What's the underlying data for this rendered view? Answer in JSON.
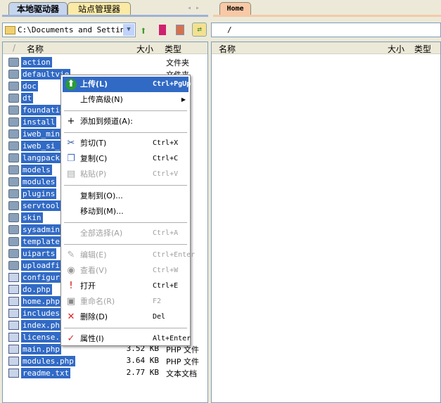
{
  "tabs": {
    "local": "本地驱动器",
    "site": "站点管理器",
    "remote": "Home"
  },
  "local": {
    "path": "C:\\Documents and Settings",
    "columns": {
      "name": "名称",
      "size": "大小",
      "type": "类型"
    },
    "files": [
      {
        "name": "action",
        "size": "",
        "type": "文件夹",
        "kind": "folder"
      },
      {
        "name": "defaultvie",
        "size": "",
        "type": "文件夹",
        "kind": "folder"
      },
      {
        "name": "doc",
        "size": "",
        "type": "",
        "kind": "folder"
      },
      {
        "name": "dt",
        "size": "",
        "type": "",
        "kind": "folder"
      },
      {
        "name": "foundation",
        "size": "",
        "type": "",
        "kind": "folder"
      },
      {
        "name": "install",
        "size": "",
        "type": "",
        "kind": "folder"
      },
      {
        "name": "iweb_mini_",
        "size": "",
        "type": "",
        "kind": "folder"
      },
      {
        "name": "iweb_si_li",
        "size": "",
        "type": "",
        "kind": "folder"
      },
      {
        "name": "langpacka",
        "size": "",
        "type": "",
        "kind": "folder"
      },
      {
        "name": "models",
        "size": "",
        "type": "",
        "kind": "folder"
      },
      {
        "name": "modules",
        "size": "",
        "type": "",
        "kind": "folder"
      },
      {
        "name": "plugins",
        "size": "",
        "type": "",
        "kind": "folder"
      },
      {
        "name": "servtools",
        "size": "",
        "type": "",
        "kind": "folder"
      },
      {
        "name": "skin",
        "size": "",
        "type": "",
        "kind": "folder"
      },
      {
        "name": "sysadmin",
        "size": "",
        "type": "",
        "kind": "folder"
      },
      {
        "name": "templates",
        "size": "",
        "type": "",
        "kind": "folder"
      },
      {
        "name": "uiparts",
        "size": "",
        "type": "",
        "kind": "folder"
      },
      {
        "name": "uploadfile",
        "size": "",
        "type": "",
        "kind": "folder"
      },
      {
        "name": "configurat",
        "size": "",
        "type": "件",
        "kind": "php"
      },
      {
        "name": "do.php",
        "size": "",
        "type": "件",
        "kind": "php"
      },
      {
        "name": "home.php",
        "size": "",
        "type": "件",
        "kind": "php"
      },
      {
        "name": "includes.p",
        "size": "",
        "type": "件",
        "kind": "php"
      },
      {
        "name": "index.php",
        "size": "",
        "type": "件",
        "kind": "php"
      },
      {
        "name": "license.tx",
        "size": "",
        "type": "档",
        "kind": "txt"
      },
      {
        "name": "main.php",
        "size": "3.52 KB",
        "type": "PHP 文件",
        "kind": "php"
      },
      {
        "name": "modules.php",
        "size": "3.64 KB",
        "type": "PHP 文件",
        "kind": "php"
      },
      {
        "name": "readme.txt",
        "size": "2.77 KB",
        "type": "文本文档",
        "kind": "txt"
      }
    ]
  },
  "remote": {
    "path": "/",
    "columns": {
      "name": "名称",
      "size": "大小",
      "type": "类型"
    }
  },
  "menu": [
    {
      "label": "上传(L)",
      "shortcut": "Ctrl+PgUp",
      "icon": "upload-icon",
      "selected": true
    },
    {
      "label": "上传高级(N)",
      "shortcut": "",
      "submenu": true
    },
    {
      "sep": true
    },
    {
      "label": "添加到频道(A):",
      "shortcut": "",
      "icon": "plus-icon"
    },
    {
      "sep": true
    },
    {
      "label": "剪切(T)",
      "shortcut": "Ctrl+X",
      "icon": "scissors-icon"
    },
    {
      "label": "复制(C)",
      "shortcut": "Ctrl+C",
      "icon": "copy-icon"
    },
    {
      "label": "粘贴(P)",
      "shortcut": "Ctrl+V",
      "icon": "paste-icon",
      "disabled": true
    },
    {
      "sep": true
    },
    {
      "label": "复制到(O)...",
      "shortcut": ""
    },
    {
      "label": "移动到(M)...",
      "shortcut": ""
    },
    {
      "sep": true
    },
    {
      "label": "全部选择(A)",
      "shortcut": "Ctrl+A",
      "disabled": true
    },
    {
      "sep": true
    },
    {
      "label": "编辑(E)",
      "shortcut": "Ctrl+Enter",
      "icon": "edit-icon",
      "disabled": true
    },
    {
      "label": "查看(V)",
      "shortcut": "Ctrl+W",
      "icon": "view-icon",
      "disabled": true
    },
    {
      "label": "打开",
      "shortcut": "Ctrl+E",
      "icon": "open-icon"
    },
    {
      "label": "重命名(R)",
      "shortcut": "F2",
      "icon": "rename-icon",
      "disabled": true
    },
    {
      "label": "删除(D)",
      "shortcut": "Del",
      "icon": "delete-icon"
    },
    {
      "sep": true
    },
    {
      "label": "属性(I)",
      "shortcut": "Alt+Enter",
      "icon": "properties-icon"
    }
  ]
}
